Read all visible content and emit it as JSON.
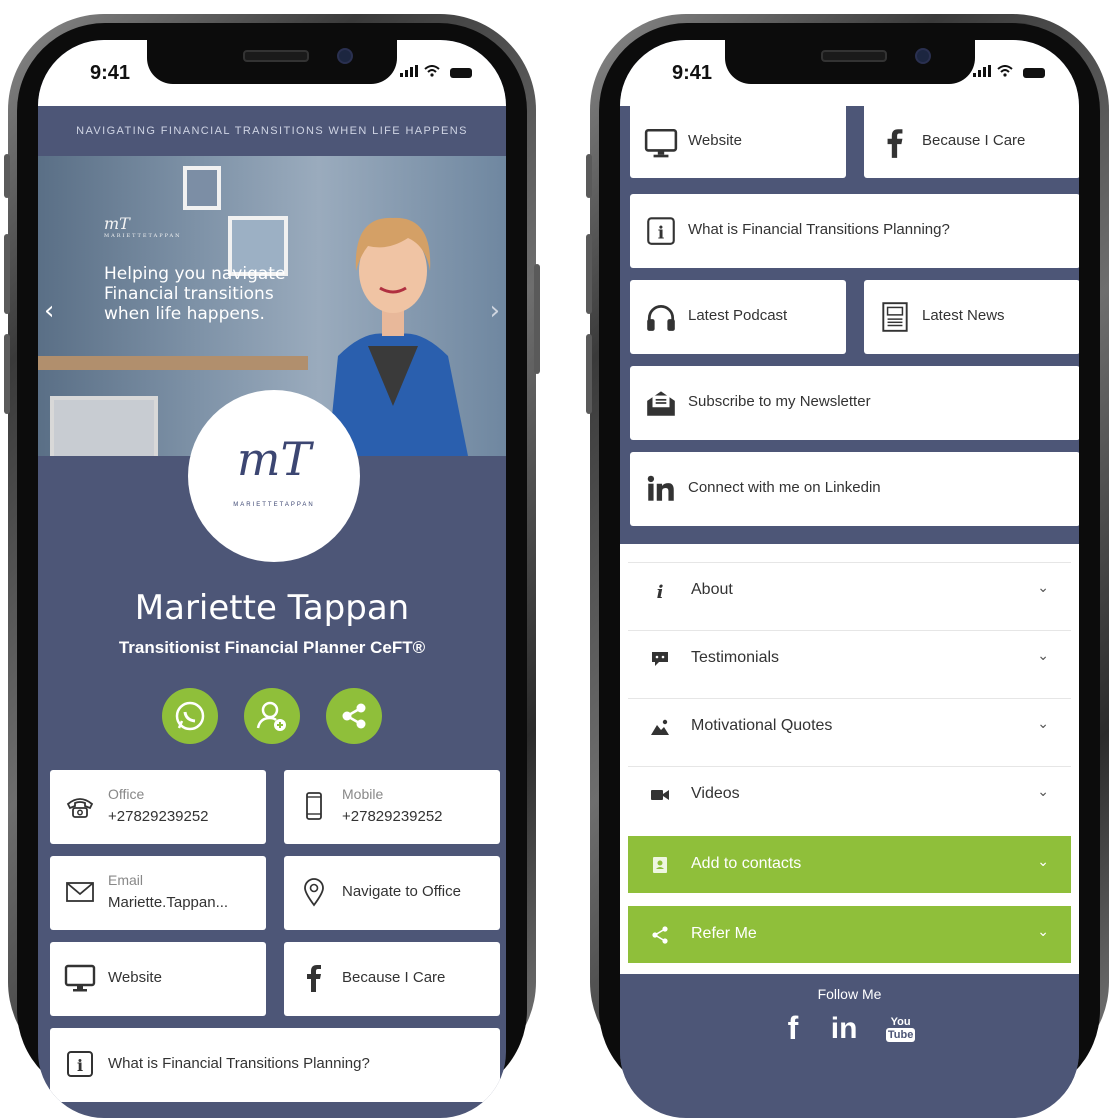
{
  "status_bar": {
    "time": "9:41"
  },
  "left": {
    "tagline": "NAVIGATING FINANCIAL TRANSITIONS WHEN LIFE HAPPENS",
    "hero": {
      "logo_mark": "mT",
      "logo_sub": "MARIETTETAPPAN",
      "text_line1": "Helping you navigate",
      "text_line2": "Financial transitions",
      "text_line3": "when life happens.",
      "prev_arrow": "‹",
      "next_arrow": "›"
    },
    "logo": {
      "mark": "mT",
      "sub": "MARIETTETAPPAN"
    },
    "profile": {
      "name": "Mariette Tappan",
      "title": "Transitionist Financial Planner CeFT®"
    },
    "actions": [
      "whatsapp-icon",
      "add-contact-icon",
      "share-icon"
    ],
    "contacts": {
      "office_label": "Office",
      "office_value": "+27829239252",
      "mobile_label": "Mobile",
      "mobile_value": "+27829239252",
      "email_label": "Email",
      "email_value": "Mariette.Tappan...",
      "navigate": "Navigate to Office",
      "website": "Website",
      "because": "Because I Care",
      "what_is": "What is Financial Transitions Planning?"
    }
  },
  "right": {
    "buttons": {
      "website": "Website",
      "because": "Because I Care",
      "what_is": "What is Financial Transitions Planning?",
      "podcast": "Latest Podcast",
      "news": "Latest News",
      "subscribe": "Subscribe to my Newsletter",
      "linkedin": "Connect with me on Linkedin"
    },
    "accordion": [
      {
        "label": "About",
        "icon": "info-icon"
      },
      {
        "label": "Testimonials",
        "icon": "speech-bubble-icon"
      },
      {
        "label": "Motivational Quotes",
        "icon": "image-icon"
      },
      {
        "label": "Videos",
        "icon": "video-camera-icon"
      },
      {
        "label": "Add to contacts",
        "icon": "address-book-icon"
      },
      {
        "label": "Refer Me",
        "icon": "share-icon"
      }
    ],
    "follow": {
      "label": "Follow Me",
      "facebook": "f",
      "linkedin": "in",
      "youtube_top": "You",
      "youtube_bottom": "Tube"
    }
  },
  "colors": {
    "navy": "#4d5677",
    "green": "#8fbf3a",
    "white": "#ffffff"
  }
}
